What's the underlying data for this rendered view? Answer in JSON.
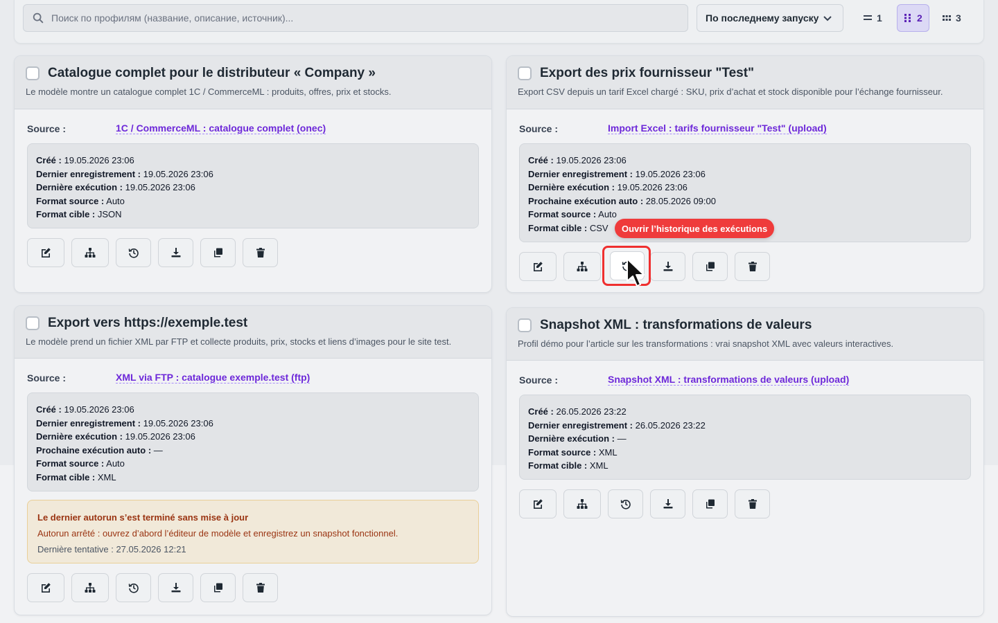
{
  "search": {
    "placeholder": "Поиск по профилям (название, описание, источник)..."
  },
  "sort": {
    "label": "По последнему запуску"
  },
  "columns": [
    {
      "label": "1",
      "active": false
    },
    {
      "label": "2",
      "active": true
    },
    {
      "label": "3",
      "active": false
    }
  ],
  "labels": {
    "source": "Source :",
    "created": "Créé :",
    "last_saved": "Dernier enregistrement :",
    "last_run": "Dernière exécution :",
    "next_auto": "Prochaine exécution auto :",
    "source_format": "Format source :",
    "target_format": "Format cible :"
  },
  "cards": [
    {
      "title": "Catalogue complet pour le distributeur « Company »",
      "description": "Le modèle montre un catalogue complet 1C / CommerceML : produits, offres, prix et stocks.",
      "source": "1C / CommerceML : catalogue complet (onec)",
      "created": "19.05.2026 23:06",
      "last_saved": "19.05.2026 23:06",
      "last_run": "19.05.2026 23:06",
      "source_format": "Auto",
      "target_format": "JSON"
    },
    {
      "title": "Export des prix fournisseur \"Test\"",
      "description": "Export CSV depuis un tarif Excel chargé : SKU, prix d’achat et stock disponible pour l’échange fournisseur.",
      "source": "Import Excel : tarifs fournisseur \"Test\" (upload)",
      "created": "19.05.2026 23:06",
      "last_saved": "19.05.2026 23:06",
      "last_run": "19.05.2026 23:06",
      "next_auto": "28.05.2026 09:00",
      "source_format": "Auto",
      "target_format": "CSV"
    },
    {
      "title": "Export vers https://exemple.test",
      "description": "Le modèle prend un fichier XML par FTP et collecte produits, prix, stocks et liens d’images pour le site test.",
      "source": "XML via FTP : catalogue exemple.test (ftp)",
      "created": "19.05.2026 23:06",
      "last_saved": "19.05.2026 23:06",
      "last_run": "19.05.2026 23:06",
      "next_auto": "—",
      "source_format": "Auto",
      "target_format": "XML",
      "warning": {
        "title": "Le dernier autorun s’est terminé sans mise à jour",
        "text": "Autorun arrêté : ouvrez d’abord l’éditeur de modèle et enregistrez un snapshot fonctionnel.",
        "last_attempt": "Dernière tentative : 27.05.2026 12:21"
      }
    },
    {
      "title": "Snapshot XML : transformations de valeurs",
      "description": "Profil démo pour l’article sur les transformations : vrai snapshot XML avec valeurs interactives.",
      "source": "Snapshot XML : transformations de valeurs (upload)",
      "created": "26.05.2026 23:22",
      "last_saved": "26.05.2026 23:22",
      "last_run": "—",
      "source_format": "XML",
      "target_format": "XML"
    }
  ],
  "tooltip": {
    "text": "Ouvrir l’historique des exécutions"
  },
  "icons": [
    "search-icon",
    "chevron-down-icon",
    "list-1-col-icon",
    "grid-2-col-icon",
    "grid-3-col-icon",
    "edit-icon",
    "sitemap-icon",
    "history-icon",
    "download-icon",
    "copy-icon",
    "trash-icon",
    "cursor-icon"
  ],
  "colors": {
    "accent": "#6d28d9",
    "tooltip": "#ef3b3b",
    "warning_text": "#9a3412"
  }
}
